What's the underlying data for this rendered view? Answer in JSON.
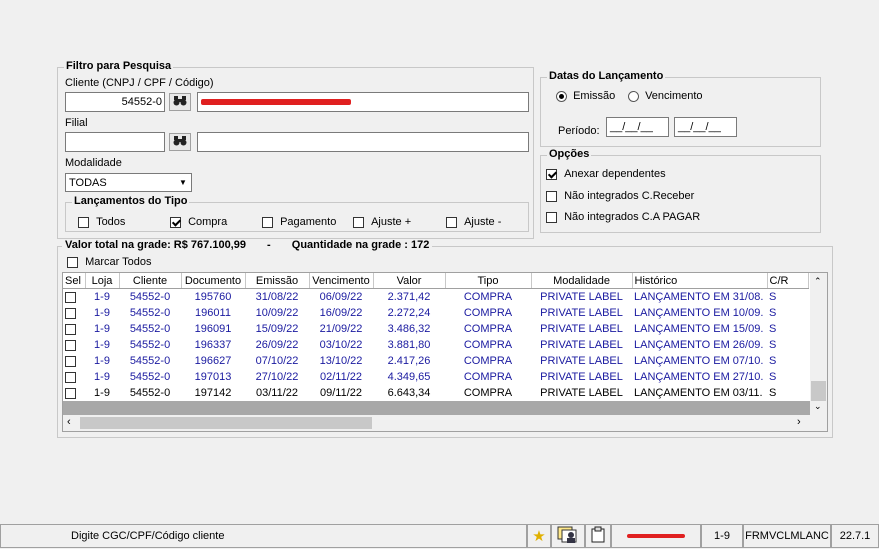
{
  "filter": {
    "title": "Filtro para Pesquisa",
    "client_label": "Cliente (CNPJ / CPF / Código)",
    "client_code": "54552-0",
    "filial_label": "Filial",
    "modalidade_label": "Modalidade",
    "modalidade_value": "TODAS"
  },
  "tipo": {
    "title": "Lançamentos do Tipo",
    "options": [
      {
        "label": "Todos",
        "checked": false
      },
      {
        "label": "Compra",
        "checked": true
      },
      {
        "label": "Pagamento",
        "checked": false
      },
      {
        "label": "Ajuste +",
        "checked": false
      },
      {
        "label": "Ajuste -",
        "checked": false
      }
    ]
  },
  "datas": {
    "title": "Datas do Lançamento",
    "emissao_label": "Emissão",
    "vencimento_label": "Vencimento",
    "periodo_label": "Período:",
    "date_from": "__/__/__",
    "date_to": "__/__/__"
  },
  "opcoes": {
    "title": "Opções",
    "items": [
      {
        "label": "Anexar dependentes",
        "checked": true
      },
      {
        "label": "Não integrados C.Receber",
        "checked": false
      },
      {
        "label": "Não integrados C.A PAGAR",
        "checked": false
      }
    ]
  },
  "summary": {
    "total_label": "Valor total na grade: R$ 767.100,99",
    "separator": "-",
    "quantity_label": "Quantidade na grade : 172"
  },
  "marcar_todos": "Marcar Todos",
  "grid": {
    "columns": [
      "Sel",
      "Loja",
      "Cliente",
      "Documento",
      "Emissão",
      "Vencimento",
      "Valor",
      "Tipo",
      "Modalidade",
      "Histórico",
      "C/R"
    ],
    "rows": [
      [
        "1-9",
        "54552-0",
        "195760",
        "31/08/22",
        "06/09/22",
        "2.371,42",
        "COMPRA",
        "PRIVATE LABEL",
        "LANÇAMENTO EM 31/08.",
        "S"
      ],
      [
        "1-9",
        "54552-0",
        "196011",
        "10/09/22",
        "16/09/22",
        "2.272,24",
        "COMPRA",
        "PRIVATE LABEL",
        "LANÇAMENTO EM 10/09.",
        "S"
      ],
      [
        "1-9",
        "54552-0",
        "196091",
        "15/09/22",
        "21/09/22",
        "3.486,32",
        "COMPRA",
        "PRIVATE LABEL",
        "LANÇAMENTO EM 15/09.",
        "S"
      ],
      [
        "1-9",
        "54552-0",
        "196337",
        "26/09/22",
        "03/10/22",
        "3.881,80",
        "COMPRA",
        "PRIVATE LABEL",
        "LANÇAMENTO EM 26/09.",
        "S"
      ],
      [
        "1-9",
        "54552-0",
        "196627",
        "07/10/22",
        "13/10/22",
        "2.417,26",
        "COMPRA",
        "PRIVATE LABEL",
        "LANÇAMENTO EM 07/10.",
        "S"
      ],
      [
        "1-9",
        "54552-0",
        "197013",
        "27/10/22",
        "02/11/22",
        "4.349,65",
        "COMPRA",
        "PRIVATE LABEL",
        "LANÇAMENTO EM 27/10.",
        "S"
      ],
      [
        "1-9",
        "54552-0",
        "197142",
        "03/11/22",
        "09/11/22",
        "6.643,34",
        "COMPRA",
        "PRIVATE LABEL",
        "LANÇAMENTO EM 03/11.",
        "S"
      ]
    ]
  },
  "status": {
    "hint": "Digite CGC/CPF/Código cliente",
    "loja": "1-9",
    "form": "FRMVCLMLANC",
    "version": "22.7.1"
  },
  "colors": {
    "row_text": "#1a1aa0",
    "redaction": "#e02020",
    "scroll_gray": "#a8a8a8"
  }
}
